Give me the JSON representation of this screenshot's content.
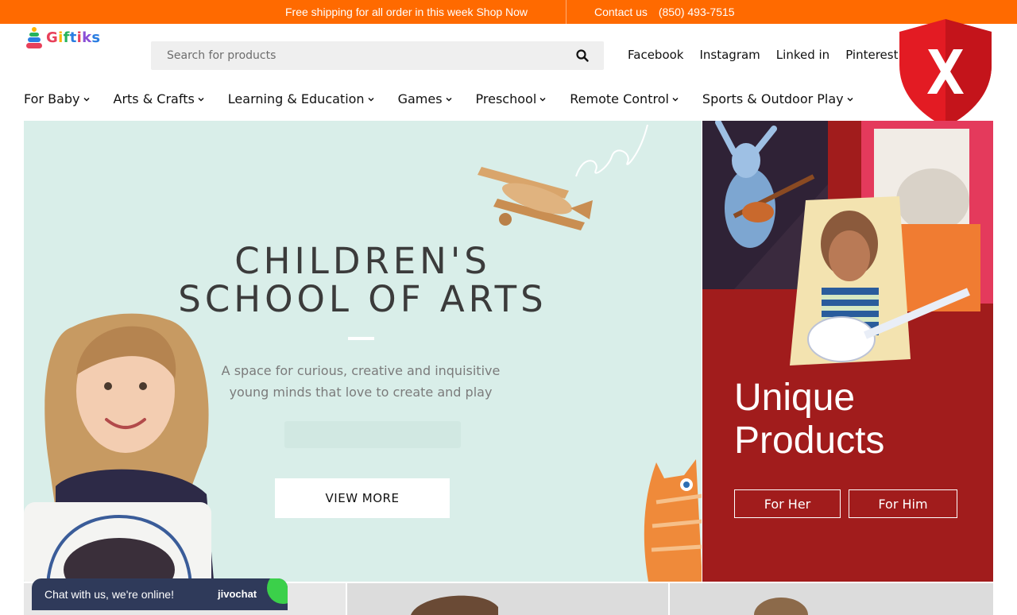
{
  "topbar": {
    "promo": "Free shipping for all order in this week Shop Now",
    "contact_label": "Contact us",
    "phone": "(850) 493-7515",
    "bg_color": "#ff6a00"
  },
  "logo": {
    "text": "Giftiks"
  },
  "search": {
    "placeholder": "Search for products",
    "icon": "search-icon"
  },
  "social": [
    "Facebook",
    "Instagram",
    "Linked in",
    "Pinterest"
  ],
  "overlay": {
    "icon": "shield-x-icon",
    "color": "#e31b23"
  },
  "nav": [
    {
      "label": "For Baby"
    },
    {
      "label": "Arts & Crafts"
    },
    {
      "label": "Learning & Education"
    },
    {
      "label": "Games"
    },
    {
      "label": "Preschool"
    },
    {
      "label": "Remote Control"
    },
    {
      "label": "Sports & Outdoor Play"
    }
  ],
  "hero": {
    "title_line1": "CHILDREN'S",
    "title_line2": "SCHOOL OF ARTS",
    "subtitle_line1": "A space for curious, creative and inquisitive",
    "subtitle_line2": "young minds that love to create and play",
    "button_label": "VIEW MORE",
    "bg_color": "#d9eee9"
  },
  "promo_panel": {
    "heading_line1": "Unique",
    "heading_line2": "Products",
    "buttons": [
      "For Her",
      "For Him"
    ],
    "bg_color": "#a11c1c"
  },
  "chat": {
    "message": "Chat with us, we're online!",
    "brand": "jivochat"
  }
}
